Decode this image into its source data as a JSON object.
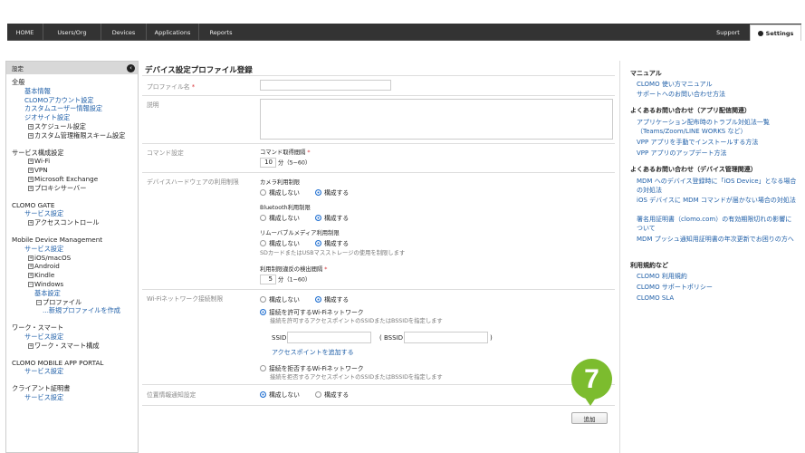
{
  "topnav": {
    "items": [
      "HOME",
      "Users/Org",
      "Devices",
      "Applications",
      "Reports"
    ],
    "support": "Support",
    "settings": "Settings"
  },
  "sidebar": {
    "header": "設定",
    "collapse": "‹",
    "groups": [
      {
        "title": "全般",
        "items": [
          {
            "label": "基本情報",
            "link": true,
            "indent": 1
          },
          {
            "label": "CLOMOアカウント設定",
            "link": true,
            "indent": 1
          },
          {
            "label": "カスタムユーザー情報設定",
            "link": true,
            "indent": 1
          },
          {
            "label": "ジオサイト設定",
            "link": true,
            "indent": 1
          },
          {
            "label": "スケジュール設定",
            "link": false,
            "indent": 2,
            "pm": "+"
          },
          {
            "label": "カスタム管理権限スキーム設定",
            "link": false,
            "indent": 2,
            "pm": "+"
          }
        ]
      },
      {
        "title": "サービス構成設定",
        "items": [
          {
            "label": "Wi-Fi",
            "link": false,
            "indent": 2,
            "pm": "+"
          },
          {
            "label": "VPN",
            "link": false,
            "indent": 2,
            "pm": "+"
          },
          {
            "label": "Microsoft Exchange",
            "link": false,
            "indent": 2,
            "pm": "+"
          },
          {
            "label": "プロキシサーバー",
            "link": false,
            "indent": 2,
            "pm": "+"
          }
        ]
      },
      {
        "title": "CLOMO GATE",
        "items": [
          {
            "label": "サービス設定",
            "link": true,
            "indent": 1
          },
          {
            "label": "アクセスコントロール",
            "link": false,
            "indent": 2,
            "pm": "+"
          }
        ]
      },
      {
        "title": "Mobile Device Management",
        "items": [
          {
            "label": "サービス設定",
            "link": true,
            "indent": 1
          },
          {
            "label": "iOS/macOS",
            "link": false,
            "indent": 2,
            "pm": "+"
          },
          {
            "label": "Android",
            "link": false,
            "indent": 2,
            "pm": "+"
          },
          {
            "label": "Kindle",
            "link": false,
            "indent": 2,
            "pm": "+"
          },
          {
            "label": "Windows",
            "link": false,
            "indent": 2,
            "pm": "−"
          },
          {
            "label": "基本設定",
            "link": true,
            "indent": 3
          },
          {
            "label": "プロファイル",
            "link": false,
            "indent": 5,
            "pm": "−"
          },
          {
            "label": "...新規プロファイルを作成",
            "link": true,
            "indent": 4
          }
        ]
      },
      {
        "title": "ワーク・スマート",
        "items": [
          {
            "label": "サービス設定",
            "link": true,
            "indent": 1
          },
          {
            "label": "ワーク・スマート構成",
            "link": false,
            "indent": 2,
            "pm": "+"
          }
        ]
      },
      {
        "title": "CLOMO MOBILE APP PORTAL",
        "items": [
          {
            "label": "サービス設定",
            "link": true,
            "indent": 1
          }
        ]
      },
      {
        "title": "クライアント証明書",
        "items": [
          {
            "label": "サービス設定",
            "link": true,
            "indent": 1
          }
        ]
      }
    ]
  },
  "form": {
    "title": "デバイス設定プロファイル登録",
    "profile_name_label": "プロファイル名",
    "required_mark": "*",
    "description_label": "説明",
    "command_label": "コマンド設定",
    "command_interval_label": "コマンド取得間隔",
    "command_interval_value": "10",
    "command_interval_unit": "分（5~60）",
    "hardware_label": "デバイスハードウェアの利用制限",
    "camera_label": "カメラ利用制限",
    "bluetooth_label": "Bluetooth利用制限",
    "removable_label": "リムーバブルメディア利用制限",
    "removable_note": "SDカードまたはUSBマスストレージの使用を制限します",
    "breach_label": "利用制限違反の検出間隔",
    "breach_value": "5",
    "breach_unit": "分（1~60）",
    "no_config": "構成しない",
    "config": "構成する",
    "wifi_label": "Wi-Fiネットワーク接続制限",
    "wifi_allow": "接続を許可するWi-Fiネットワーク",
    "wifi_allow_note": "接続を許可するアクセスポイントのSSIDまたはBSSIDを指定します",
    "ssid_label": "SSID",
    "bssid_label": "( BSSID",
    "bssid_close": ")",
    "add_ap": "アクセスポイントを追加する",
    "wifi_deny": "接続を拒否するWi-Fiネットワーク",
    "wifi_deny_note": "接続を拒否するアクセスポイントのSSIDまたはBSSIDを指定します",
    "location_label": "位置情報通知設定",
    "add_button": "追加",
    "step_badge": "7"
  },
  "right": {
    "sections": [
      {
        "title": "マニュアル",
        "links": [
          "CLOMO 使い方マニュアル",
          "サポートへのお問い合わせ方法"
        ]
      },
      {
        "title": "よくあるお問い合わせ（アプリ配信関連）",
        "links": [
          "アプリケーション配布時のトラブル対処法一覧（Teams/Zoom/LINE WORKS など）",
          "VPP アプリを手動でインストールする方法",
          "VPP アプリのアップデート方法"
        ]
      },
      {
        "title": "よくあるお問い合わせ（デバイス管理関連）",
        "links": [
          "MDM へのデバイス登録時に「iOS Device」となる場合の対処法",
          "iOS デバイスに MDM コマンドが届かない場合の対処法",
          "署名用証明書（clomo.com）の有効期限切れの影響について",
          "MDM プッシュ通知用証明書の年次更新でお困りの方へ"
        ]
      },
      {
        "title": "利用規約など",
        "links": [
          "CLOMO 利用規約",
          "CLOMO サポートポリシー",
          "CLOMO SLA"
        ]
      }
    ]
  },
  "colors": {
    "accent": "#1f6fd1",
    "link": "#1f5fa8",
    "badge": "#7cbc2e",
    "required": "#d9373b",
    "topbar": "#333333"
  }
}
